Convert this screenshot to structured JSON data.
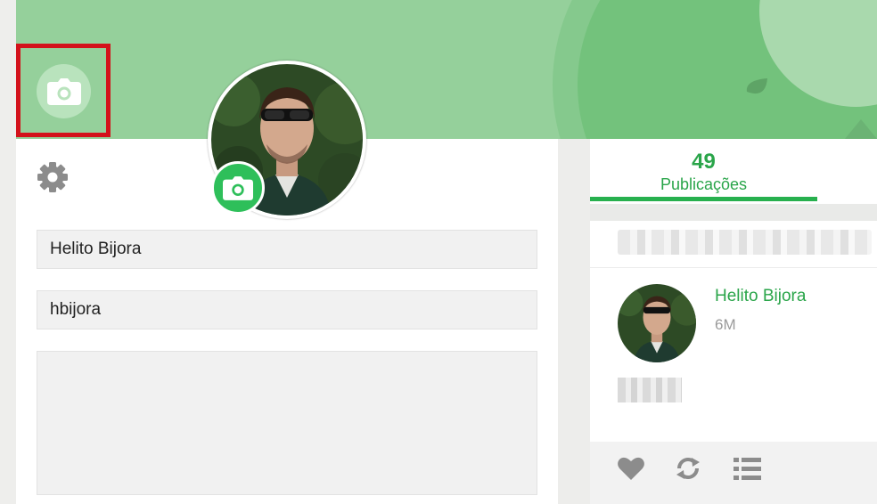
{
  "colors": {
    "cover_green": "#95d09b",
    "accent_green": "#2aa54a",
    "button_green": "#2ebf5a",
    "highlight_red": "#d3121b"
  },
  "cover": {
    "camera_button_icon": "camera-icon",
    "highlighted": true
  },
  "profile": {
    "settings_icon": "gear-icon",
    "avatar_camera_icon": "camera-icon",
    "name_value": "Helito Bijora",
    "username_value": "hbijora",
    "bio_value": ""
  },
  "stats": {
    "count": "49",
    "label": "Publicações",
    "active_fraction": 0.8
  },
  "post": {
    "author": "Helito Bijora",
    "time": "6M",
    "actions": [
      "heart-icon",
      "repost-icon",
      "list-icon"
    ]
  }
}
